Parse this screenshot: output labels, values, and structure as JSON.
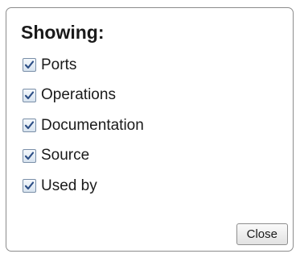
{
  "dialog": {
    "heading": "Showing:",
    "options": [
      {
        "label": "Ports",
        "checked": true,
        "icon": "checkbox-checked-icon"
      },
      {
        "label": "Operations",
        "checked": true,
        "icon": "checkbox-checked-icon"
      },
      {
        "label": "Documentation",
        "checked": true,
        "icon": "checkbox-checked-icon"
      },
      {
        "label": "Source",
        "checked": true,
        "icon": "checkbox-checked-icon"
      },
      {
        "label": "Used by",
        "checked": true,
        "icon": "checkbox-checked-icon"
      }
    ],
    "close_label": "Close"
  },
  "colors": {
    "check_mark": "#2d4f86",
    "border": "#8c8c8c"
  }
}
